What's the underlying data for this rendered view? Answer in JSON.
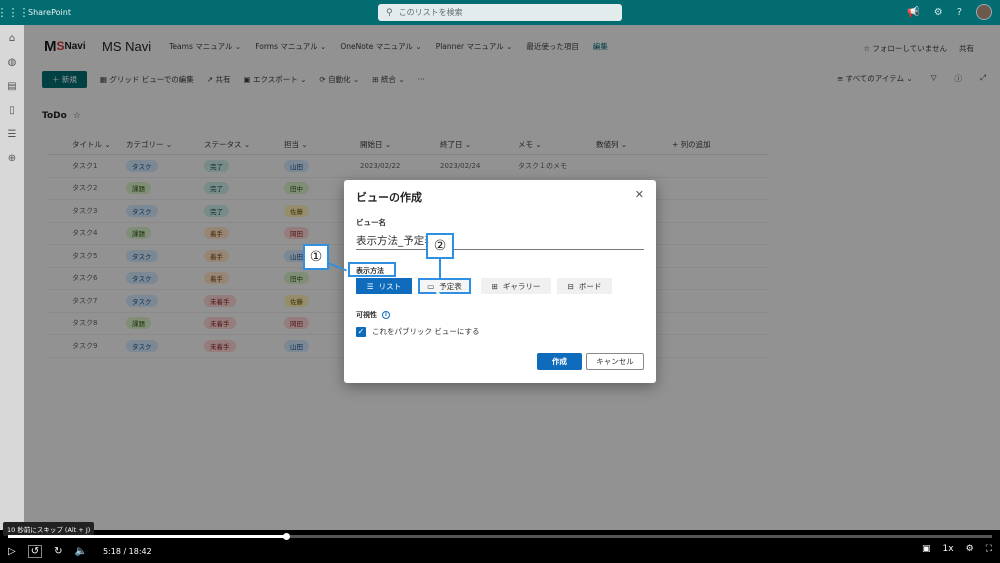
{
  "suite": {
    "app": "SharePoint",
    "search_placeholder": "このリストを検索"
  },
  "site": {
    "logo": {
      "m": "M",
      "s": "S",
      "navi": "Navi"
    },
    "name": "MS Navi",
    "nav": [
      "Teams マニュアル ⌄",
      "Forms マニュアル ⌄",
      "OneNote マニュアル ⌄",
      "Planner マニュアル ⌄",
      "最近使った項目"
    ],
    "edit": "編集",
    "follow": "☆ フォローしていません",
    "share": "共有"
  },
  "commands": {
    "new": "＋ 新規",
    "grid_edit": "グリッド ビューでの編集",
    "share": "共有",
    "export": "エクスポート ⌄",
    "automate": "自動化 ⌄",
    "integrate": "統合 ⌄",
    "more": "···",
    "all_items": "すべてのアイテム ⌄"
  },
  "list": {
    "title": "ToDo",
    "star": "☆",
    "columns": [
      "タイトル ⌄",
      "カテゴリー ⌄",
      "ステータス ⌄",
      "担当 ⌄",
      "開始日 ⌄",
      "終了日 ⌄",
      "メモ ⌄",
      "数値列 ⌄",
      "+ 列の追加"
    ],
    "rows": [
      {
        "title": "タスク1",
        "category": "タスク",
        "cat_color": "blue",
        "status": "完了",
        "status_color": "teal",
        "owner": "山田",
        "owner_color": "blue",
        "start": "2023/02/22",
        "end": "2023/02/24",
        "memo": "タスク１のメモ"
      },
      {
        "title": "タスク2",
        "category": "課題",
        "cat_color": "green",
        "status": "完了",
        "status_color": "teal",
        "owner": "田中",
        "owner_color": "green",
        "start": "",
        "end": "",
        "memo": ""
      },
      {
        "title": "タスク3",
        "category": "タスク",
        "cat_color": "blue",
        "status": "完了",
        "status_color": "teal",
        "owner": "佐藤",
        "owner_color": "yellow",
        "start": "",
        "end": "",
        "memo": ""
      },
      {
        "title": "タスク4",
        "category": "課題",
        "cat_color": "green",
        "status": "着手",
        "status_color": "orange",
        "owner": "岡田",
        "owner_color": "red",
        "start": "",
        "end": "",
        "memo": ""
      },
      {
        "title": "タスク5",
        "category": "タスク",
        "cat_color": "blue",
        "status": "着手",
        "status_color": "orange",
        "owner": "山田",
        "owner_color": "blue",
        "start": "",
        "end": "",
        "memo": ""
      },
      {
        "title": "タスク6",
        "category": "タスク",
        "cat_color": "blue",
        "status": "着手",
        "status_color": "orange",
        "owner": "田中",
        "owner_color": "green",
        "start": "",
        "end": "",
        "memo": ""
      },
      {
        "title": "タスク7",
        "category": "タスク",
        "cat_color": "blue",
        "status": "未着手",
        "status_color": "red",
        "owner": "佐藤",
        "owner_color": "yellow",
        "start": "",
        "end": "",
        "memo": ""
      },
      {
        "title": "タスク8",
        "category": "課題",
        "cat_color": "green",
        "status": "未着手",
        "status_color": "red",
        "owner": "岡田",
        "owner_color": "red",
        "start": "",
        "end": "",
        "memo": ""
      },
      {
        "title": "タスク9",
        "category": "タスク",
        "cat_color": "blue",
        "status": "未着手",
        "status_color": "red",
        "owner": "山田",
        "owner_color": "blue",
        "start": "",
        "end": "",
        "memo": ""
      }
    ]
  },
  "dialog": {
    "title": "ビューの作成",
    "close": "✕",
    "name_label": "ビュー名",
    "name_value": "表示方法_予定表",
    "method_label": "表示方法",
    "view_types": {
      "list": "リスト",
      "calendar": "予定表",
      "gallery": "ギャラリー",
      "board": "ボード"
    },
    "visibility_label": "可視性",
    "public_checkbox": "これをパブリック ビューにする",
    "create": "作成",
    "cancel": "キャンセル"
  },
  "callouts": {
    "one": "①",
    "two": "②"
  },
  "video": {
    "tooltip": "10 秒前にスキップ (Alt + J)",
    "time": "5:18 / 18:42",
    "speed": "1x",
    "progress": 0.283
  },
  "colors": {
    "accent": "#036c70",
    "primary": "#0f6cbd",
    "callout": "#2f8fe0"
  }
}
